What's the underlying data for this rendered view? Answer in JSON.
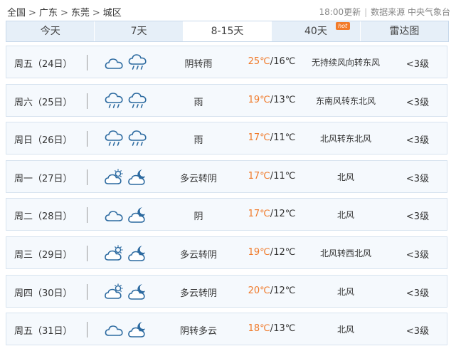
{
  "breadcrumb": {
    "items": [
      "全国",
      "广东",
      "东莞",
      "城区"
    ],
    "separator": ">"
  },
  "meta": {
    "updated": "18:00更新",
    "source": "数据来源 中央气象台"
  },
  "tabs": [
    {
      "label": "今天",
      "active": false
    },
    {
      "label": "7天",
      "active": false
    },
    {
      "label": "8-15天",
      "active": true
    },
    {
      "label": "40天",
      "active": false,
      "badge": "hot"
    },
    {
      "label": "雷达图",
      "active": false
    }
  ],
  "colors": {
    "high_temp": "#f07a2a",
    "tab_bg": "#e6eff8",
    "row_bg": "#f5f9fd",
    "badge": "#f27b2a"
  },
  "forecast": [
    {
      "date": "周五（24日）",
      "icons": [
        "cloud-icon",
        "rain-icon"
      ],
      "desc": "阴转雨",
      "high": "25℃",
      "low": "16℃",
      "wind": "无持续风向转东风",
      "level": "<3级"
    },
    {
      "date": "周六（25日）",
      "icons": [
        "rain-icon",
        "rain-icon"
      ],
      "desc": "雨",
      "high": "19℃",
      "low": "13℃",
      "wind": "东南风转东北风",
      "level": "<3级"
    },
    {
      "date": "周日（26日）",
      "icons": [
        "rain-icon",
        "rain-icon"
      ],
      "desc": "雨",
      "high": "17℃",
      "low": "11℃",
      "wind": "北风转东北风",
      "level": "<3级"
    },
    {
      "date": "周一（27日）",
      "icons": [
        "sun-cloud-icon",
        "moon-cloud-icon"
      ],
      "desc": "多云转阴",
      "high": "17℃",
      "low": "11℃",
      "wind": "北风",
      "level": "<3级"
    },
    {
      "date": "周二（28日）",
      "icons": [
        "cloud-icon",
        "moon-cloud-icon"
      ],
      "desc": "阴",
      "high": "17℃",
      "low": "12℃",
      "wind": "北风",
      "level": "<3级"
    },
    {
      "date": "周三（29日）",
      "icons": [
        "sun-cloud-icon",
        "moon-cloud-icon"
      ],
      "desc": "多云转阴",
      "high": "19℃",
      "low": "12℃",
      "wind": "北风转西北风",
      "level": "<3级"
    },
    {
      "date": "周四（30日）",
      "icons": [
        "sun-cloud-icon",
        "moon-cloud-icon"
      ],
      "desc": "多云转阴",
      "high": "20℃",
      "low": "12℃",
      "wind": "北风",
      "level": "<3级"
    },
    {
      "date": "周五（31日）",
      "icons": [
        "cloud-icon",
        "moon-cloud-icon"
      ],
      "desc": "阴转多云",
      "high": "18℃",
      "low": "13℃",
      "wind": "北风",
      "level": "<3级"
    }
  ]
}
